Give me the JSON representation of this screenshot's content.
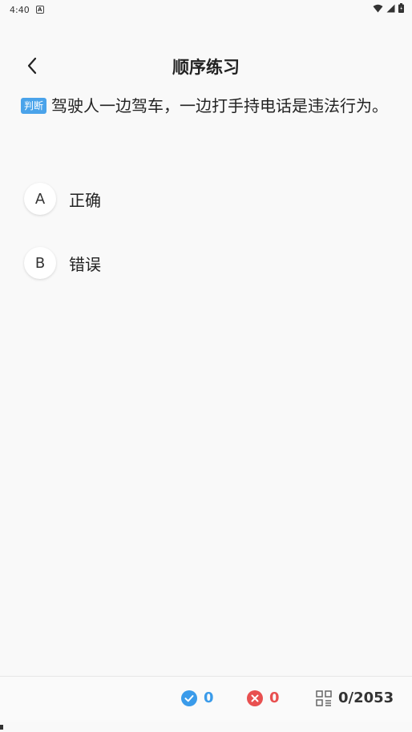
{
  "status_bar": {
    "time": "4:40",
    "notification_glyph": "A"
  },
  "header": {
    "title": "顺序练习"
  },
  "question": {
    "type_badge": "判断",
    "text": "驾驶人一边驾车，一边打手持电话是违法行为。"
  },
  "options": [
    {
      "letter": "A",
      "text": "正确"
    },
    {
      "letter": "B",
      "text": "错误"
    }
  ],
  "footer": {
    "correct_count": "0",
    "wrong_count": "0",
    "progress": "0/2053"
  },
  "colors": {
    "accent_blue": "#3a9bea",
    "error_red": "#e85050",
    "badge_blue": "#4aa3ea"
  },
  "icons": [
    "back-chevron-icon",
    "check-circle-icon",
    "x-circle-icon",
    "answer-sheet-icon",
    "wifi-icon",
    "cellular-icon",
    "battery-icon"
  ]
}
